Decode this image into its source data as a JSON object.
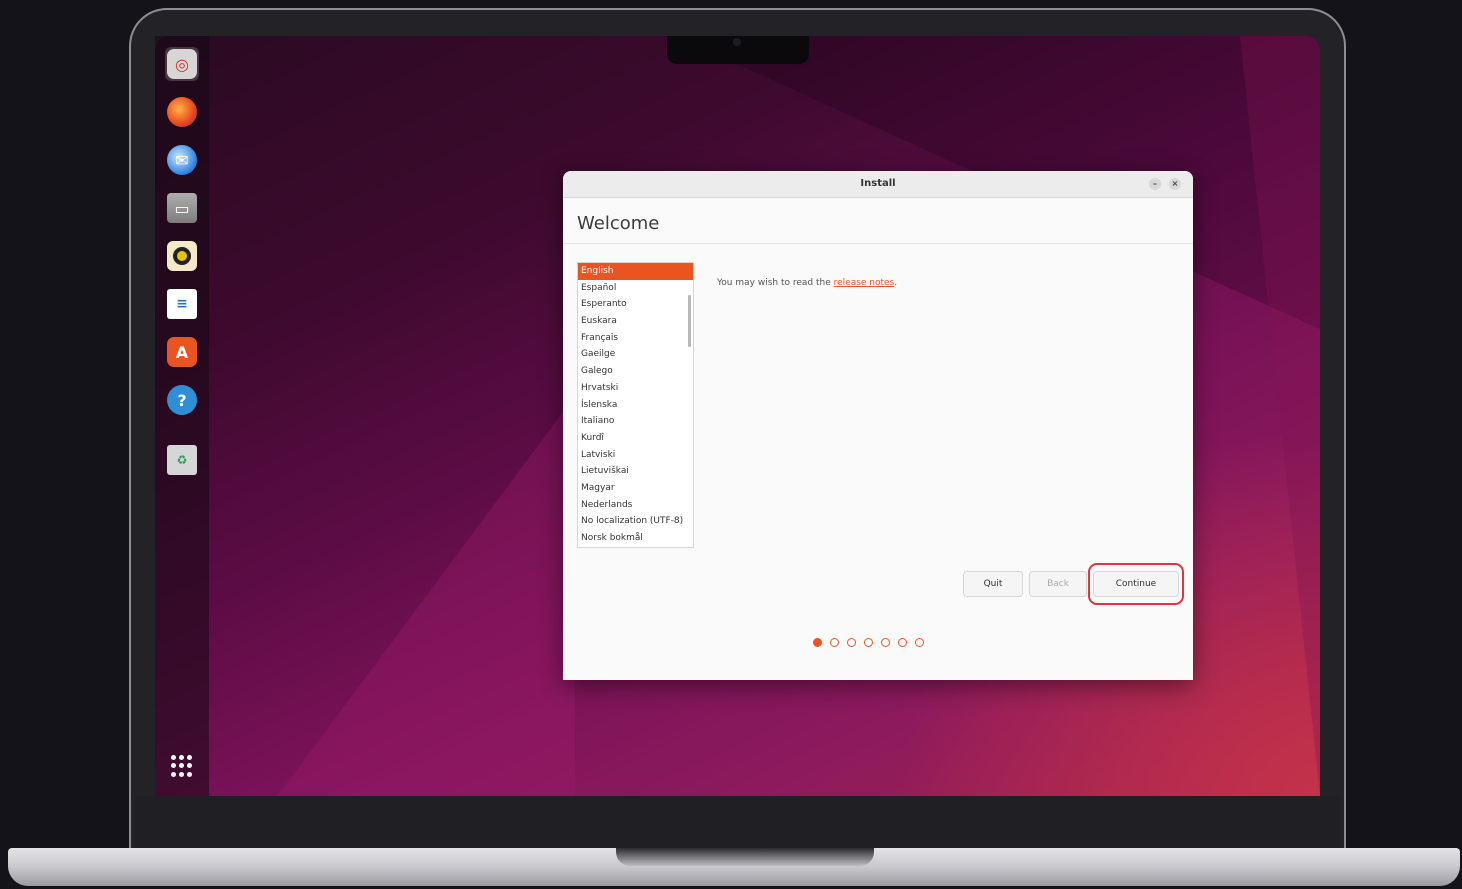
{
  "window": {
    "title": "Install",
    "minimize_glyph": "–",
    "close_glyph": "×",
    "heading": "Welcome"
  },
  "languages": [
    "English",
    "Español",
    "Esperanto",
    "Euskara",
    "Français",
    "Gaeilge",
    "Galego",
    "Hrvatski",
    "Íslenska",
    "Italiano",
    "Kurdî",
    "Latviski",
    "Lietuviškai",
    "Magyar",
    "Nederlands",
    "No localization (UTF-8)",
    "Norsk bokmål"
  ],
  "selected_language": "English",
  "release_notes": {
    "prefix": "You may wish to read the ",
    "link": "release notes",
    "suffix": "."
  },
  "buttons": {
    "quit": "Quit",
    "back": "Back",
    "continue": "Continue"
  },
  "progress": {
    "current_step": 1,
    "total_steps": 7
  },
  "dock": {
    "icons": [
      "installer-icon",
      "firefox-icon",
      "thunderbird-icon",
      "files-icon",
      "rhythmbox-icon",
      "libreoffice-writer-icon",
      "app-center-icon",
      "help-icon",
      "trash-icon"
    ]
  },
  "colors": {
    "accent": "#E95420",
    "highlight": "#E2353D"
  }
}
